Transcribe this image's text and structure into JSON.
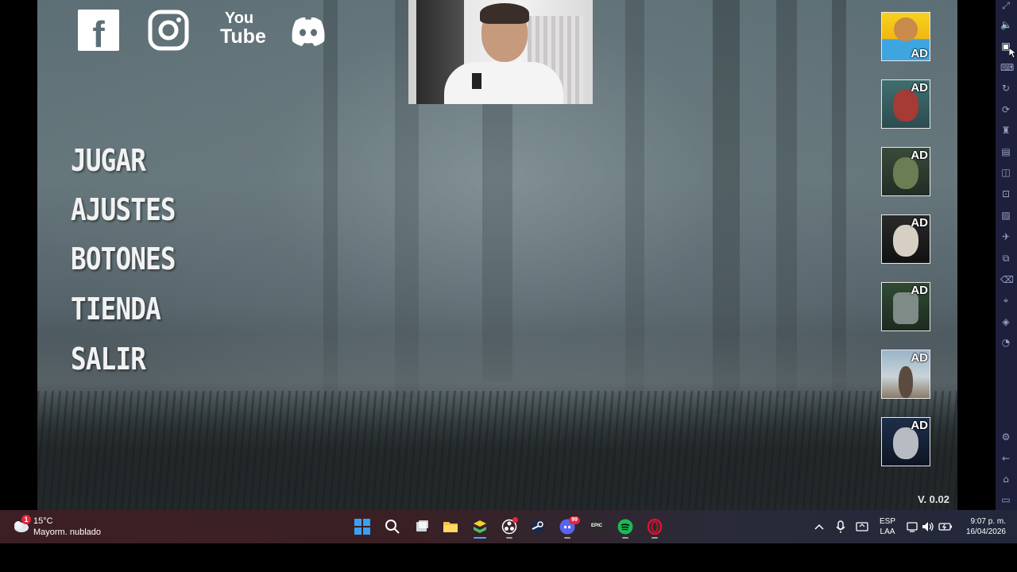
{
  "menu": {
    "play": "JUGAR",
    "settings": "AJUSTES",
    "buttons": "BOTONES",
    "store": "TIENDA",
    "exit": "SALIR"
  },
  "social": {
    "facebook_glyph": "f",
    "youtube_top": "You",
    "youtube_bottom": "Tube"
  },
  "ads": {
    "badge": "AD"
  },
  "version": "V. 0.02",
  "taskbar": {
    "weather_temp": "15°C",
    "weather_desc": "Mayorm. nublado",
    "weather_badge": "1",
    "discord_badge": "99",
    "lang_top": "ESP",
    "lang_bottom": "LAA",
    "time": "9:07 p. m.",
    "date": "16/04/2026"
  },
  "colors": {
    "sidebar": "#1e1f3a",
    "accent_blue": "#2f8cf0",
    "spotify": "#1db954",
    "opera": "#e0112b",
    "discord": "#5865f2"
  }
}
